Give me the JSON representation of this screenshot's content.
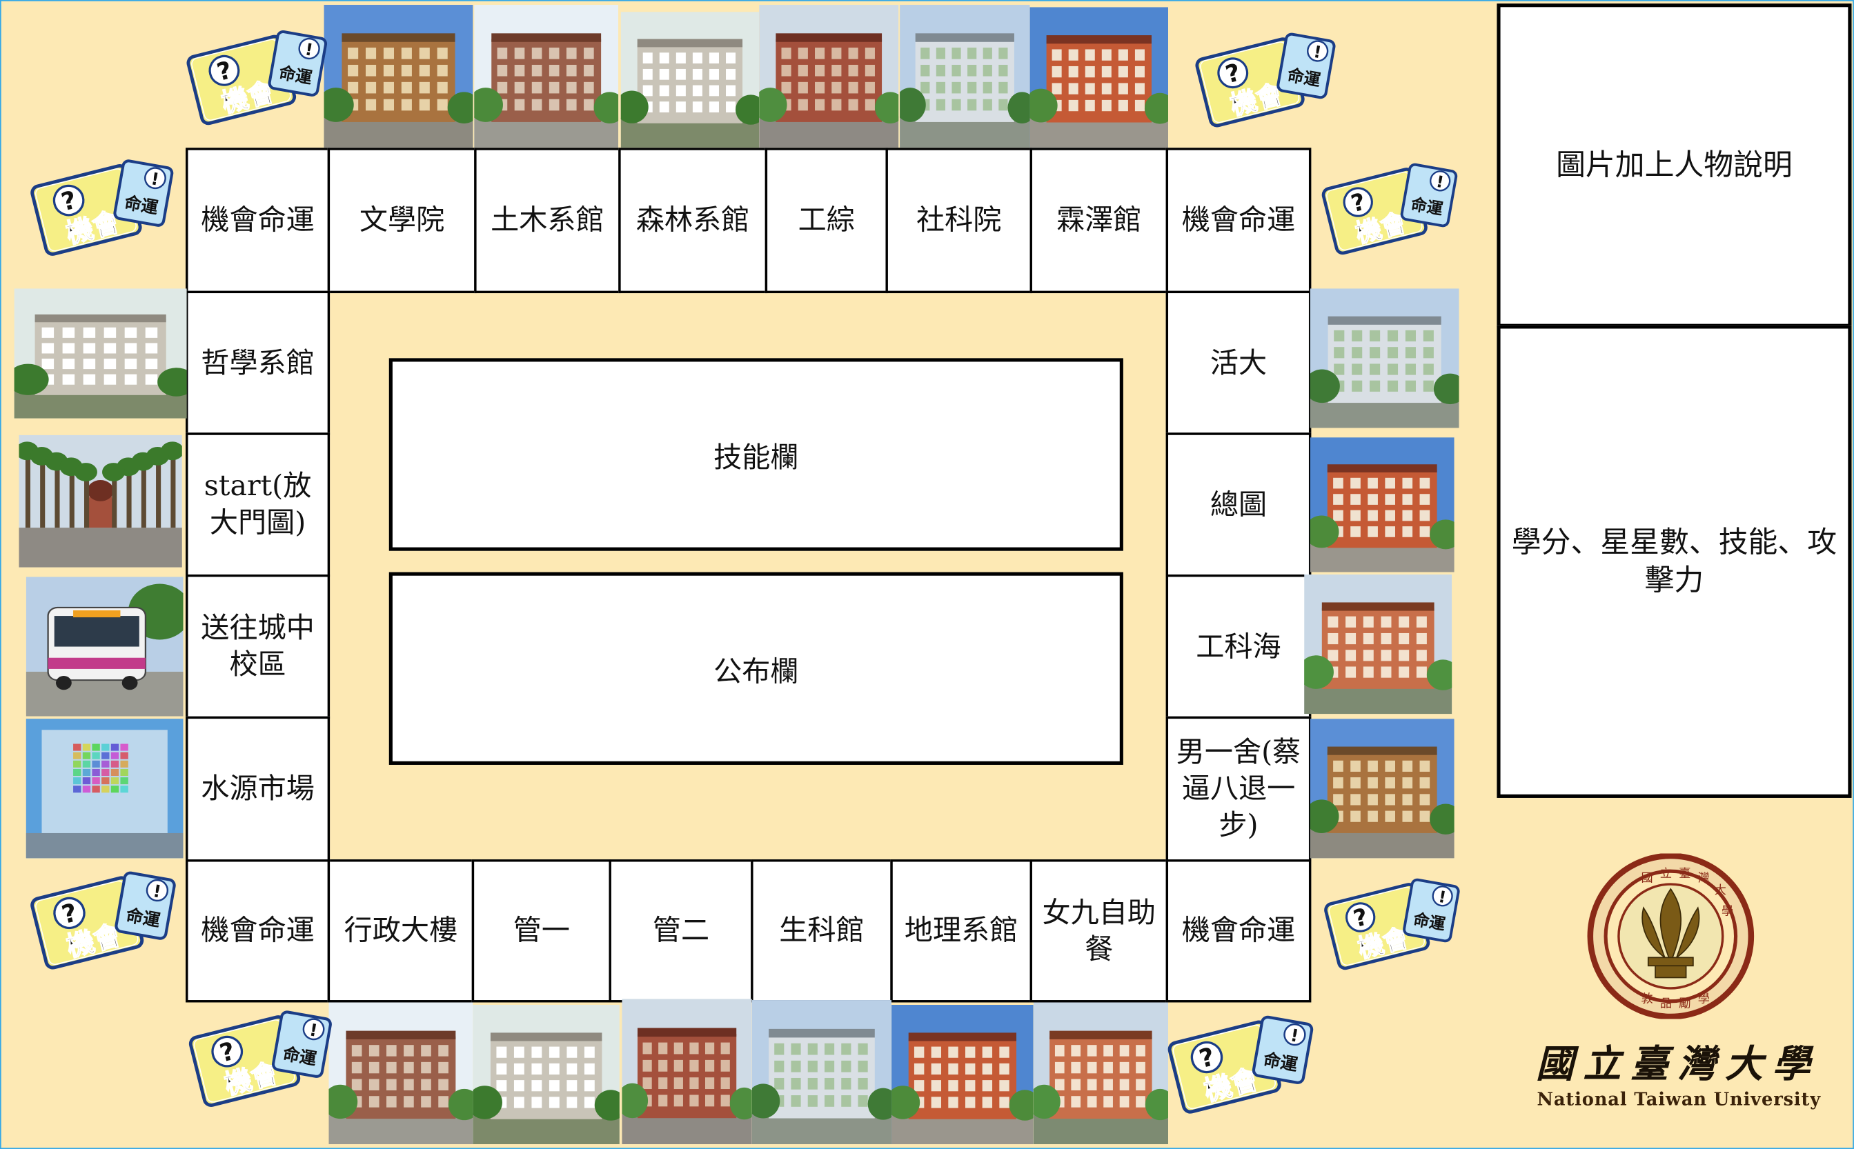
{
  "colors": {
    "board": "#fde9b4",
    "frame": "#35a9e6",
    "cardYellow": "#f6ef86",
    "cardBlue": "#bfe3f7",
    "logoBrown": "#8b2a17"
  },
  "chance_card": {
    "main": "機會",
    "fate": "命運",
    "question": "?",
    "bang": "!"
  },
  "board": {
    "top": [
      "機會命運",
      "文學院",
      "土木系館",
      "森林系館",
      "工綜",
      "社科院",
      "霖澤館",
      "機會命運"
    ],
    "left": [
      "哲學系館",
      "start(放大門圖)",
      "送往城中校區",
      "水源市場"
    ],
    "right": [
      "活大",
      "總圖",
      "工科海",
      "男一舍(蔡逼八退一步)"
    ],
    "bottom": [
      "機會命運",
      "行政大樓",
      "管一",
      "管二",
      "生科館",
      "地理系館",
      "女九自助餐",
      "機會命運"
    ]
  },
  "panels": {
    "skills": "技能欄",
    "bulletin": "公布欄"
  },
  "right_panel": {
    "top": "圖片加上人物說明",
    "bottom": "學分、星星數、技能、攻擊力"
  },
  "photos": {
    "top": [
      "literature-hall-photo",
      "civil-engineering-photo",
      "forestry-photo",
      "engineering-complex-photo",
      "social-science-photo",
      "linze-hall-photo"
    ],
    "left": [
      "philosophy-photo",
      "main-gate-palm-photo",
      "campus-bus-photo",
      "shuiyuan-market-photo"
    ],
    "right": [
      "student-activity-center-photo",
      "main-library-photo",
      "engineering-science-photo",
      "mens-dorm-photo"
    ],
    "bottom": [
      "administration-building-photo",
      "management-one-photo",
      "management-two-photo",
      "life-science-photo",
      "geography-photo",
      "womens-dorm-photo"
    ]
  },
  "logo": {
    "seal_text": "國立臺灣大學 敦品勵學 愛國愛人",
    "script_name": "國立臺灣大學",
    "english_name": "National Taiwan University"
  }
}
